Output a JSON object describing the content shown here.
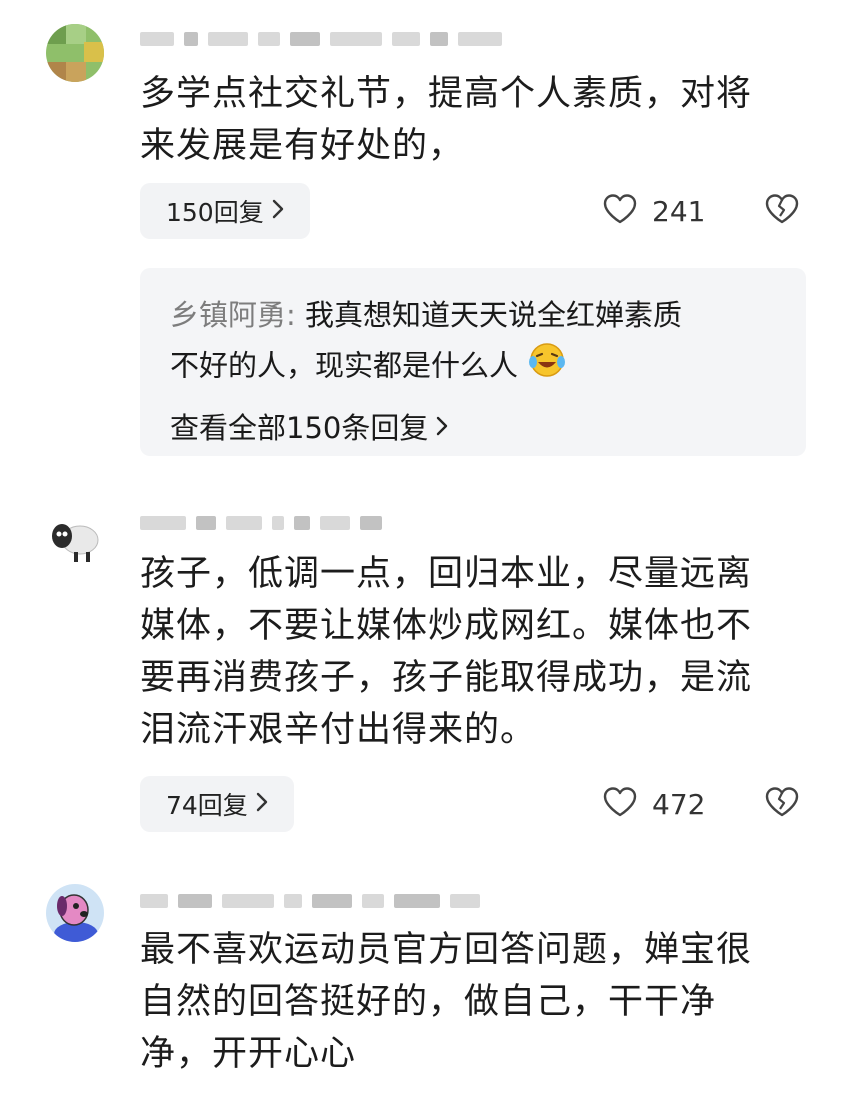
{
  "comments": [
    {
      "text_lines": [
        "多学点社交礼节，提高个人素质，对将",
        "来发展是有好处的，"
      ],
      "reply_label": "150回复",
      "likes": "241",
      "top_reply": {
        "author": "乡镇阿勇",
        "separator": ": ",
        "text_line1": "我真想知道天天说全红婵素质",
        "text_line2": "不好的人，现实都是什么人",
        "emoji": "laughing-crying-emoji"
      },
      "view_all_label": "查看全部150条回复"
    },
    {
      "text_lines": [
        "孩子，低调一点，回归本业，尽量远离",
        "媒体，不要让媒体炒成网红。媒体也不",
        "要再消费孩子，孩子能取得成功，是流",
        "泪流汗艰辛付出得来的。"
      ],
      "reply_label": "74回复",
      "likes": "472"
    },
    {
      "text_lines": [
        "最不喜欢运动员官方回答问题，婵宝很",
        "自然的回答挺好的，做自己，干干净",
        "净，开开心心"
      ]
    }
  ],
  "icons": {
    "like": "heart-outline-icon",
    "dislike": "broken-heart-icon",
    "chevron": "chevron-right-icon"
  },
  "colors": {
    "reply_bg": "#f2f3f5",
    "muted_text": "#7d7d7d"
  }
}
